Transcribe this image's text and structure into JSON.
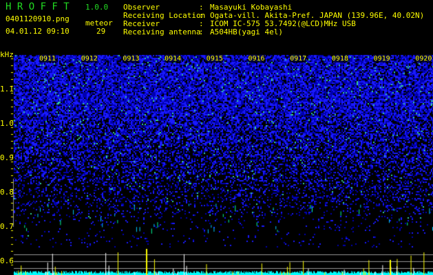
{
  "app": {
    "title": "H R O F F T",
    "version": "1.0.0"
  },
  "file": {
    "name": "0401120910.png",
    "datetime": "04.01.12 09:10"
  },
  "meteor": {
    "label": "meteor",
    "count": "29"
  },
  "info": [
    {
      "label": "Observer",
      "value": "Masayuki Kobayashi"
    },
    {
      "label": "Receiving Location",
      "value": "Ogata-vill. Akita-Pref. JAPAN (139.96E, 40.02N)"
    },
    {
      "label": "Receiver",
      "value": "ICOM IC-575 53.7492(@LCD)MHz USB"
    },
    {
      "label": "Receiving antenna",
      "value": "A504HB(yagi 4el)"
    }
  ],
  "spectrogram": {
    "unit": "kHz",
    "freq_ticks": [
      "1.1",
      "1.0",
      "0.9",
      "0.8",
      "0.7",
      "0.6"
    ],
    "time_ticks": [
      "0911",
      "0912",
      "0913",
      "0914",
      "0915",
      "0916",
      "0917",
      "0918",
      "0919",
      "0920"
    ],
    "colors": {
      "noise": "#1a1aff",
      "echo": "#00ffcc",
      "trace": "#00ffff",
      "spike": "#ffff00"
    }
  }
}
